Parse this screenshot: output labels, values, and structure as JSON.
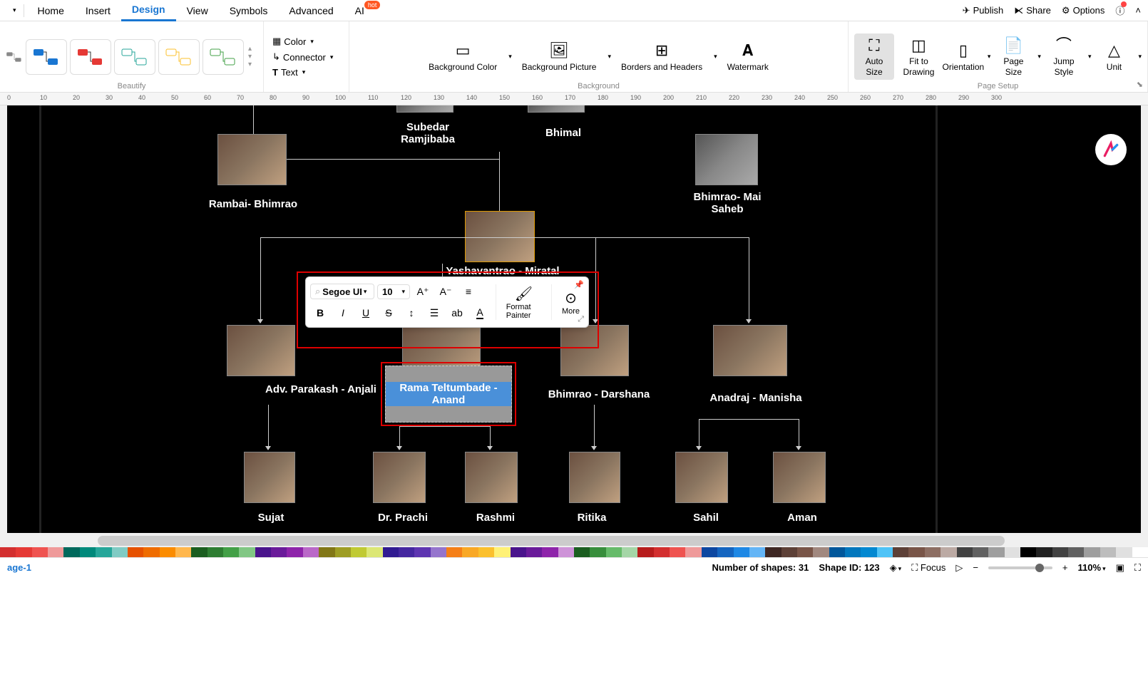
{
  "tabs": [
    "Home",
    "Insert",
    "Design",
    "View",
    "Symbols",
    "Advanced",
    "AI"
  ],
  "active_tab": 2,
  "hot_badge": "hot",
  "topbar": {
    "publish": "Publish",
    "share": "Share",
    "options": "Options"
  },
  "ribbon": {
    "beautify_label": "Beautify",
    "color": "Color",
    "connector": "Connector",
    "text": "Text",
    "bg_color": "Background Color",
    "bg_picture": "Background Picture",
    "borders": "Borders and Headers",
    "watermark": "Watermark",
    "background_label": "Background",
    "auto_size": "Auto Size",
    "fit": "Fit to Drawing",
    "orientation": "Orientation",
    "page_size": "Page Size",
    "jump_style": "Jump Style",
    "unit": "Unit",
    "page_setup_label": "Page Setup"
  },
  "ruler_marks": [
    0,
    10,
    20,
    30,
    40,
    50,
    60,
    70,
    80,
    90,
    100,
    110,
    120,
    130,
    140,
    150,
    160,
    170,
    180,
    190,
    200,
    210,
    220,
    230,
    240,
    250,
    260,
    270,
    280,
    290,
    300
  ],
  "nodes": {
    "subedar": "Subedar Ramjibaba",
    "bhimal": "Bhimal",
    "rambai": "Rambai- Bhimrao",
    "bhimrao_mai": "Bhimrao- Mai Saheb",
    "yash": "Yashavantrao - Miratal",
    "adv": "Adv. Parakash - Anjali",
    "rama": "Rama Teltumbade - Anand",
    "bhimrao_d": "Bhimrao - Darshana",
    "anadraj": "Anadraj - Manisha",
    "sujat": "Sujat",
    "prachi": "Dr. Prachi",
    "rashmi": "Rashmi",
    "ritika": "Ritika",
    "sahil": "Sahil",
    "aman": "Aman"
  },
  "float": {
    "font": "Segoe UI",
    "size": "10",
    "format_painter": "Format Painter",
    "more": "More"
  },
  "colors": [
    "#d32f2f",
    "#e53935",
    "#ef5350",
    "#ef9a9a",
    "#00695c",
    "#00897b",
    "#26a69a",
    "#80cbc4",
    "#e65100",
    "#ef6c00",
    "#fb8c00",
    "#ffb74d",
    "#1b5e20",
    "#2e7d32",
    "#43a047",
    "#81c784",
    "#4a148c",
    "#6a1b9a",
    "#8e24aa",
    "#ba68c8",
    "#827717",
    "#9e9d24",
    "#c0ca33",
    "#dce775",
    "#311b92",
    "#4527a0",
    "#5e35b1",
    "#9575cd",
    "#f57f17",
    "#f9a825",
    "#fbc02d",
    "#fff176",
    "#4a148c",
    "#6a1b9a",
    "#8e24aa",
    "#ce93d8",
    "#1b5e20",
    "#388e3c",
    "#66bb6a",
    "#a5d6a7",
    "#b71c1c",
    "#d32f2f",
    "#ef5350",
    "#ef9a9a",
    "#0d47a1",
    "#1565c0",
    "#1e88e5",
    "#64b5f6",
    "#3e2723",
    "#5d4037",
    "#795548",
    "#a1887f",
    "#01579b",
    "#0277bd",
    "#0288d1",
    "#4fc3f7",
    "#5d4037",
    "#795548",
    "#8d6e63",
    "#bcaaa4",
    "#424242",
    "#616161",
    "#9e9e9e",
    "#e0e0e0",
    "#000",
    "#212121",
    "#424242",
    "#616161",
    "#9e9e9e",
    "#bdbdbd",
    "#e0e0e0",
    "#fff"
  ],
  "status": {
    "page": "age-1",
    "shapes_label": "Number of shapes:",
    "shapes": "31",
    "shape_id_label": "Shape ID:",
    "shape_id": "123",
    "focus": "Focus",
    "zoom": "110%"
  }
}
